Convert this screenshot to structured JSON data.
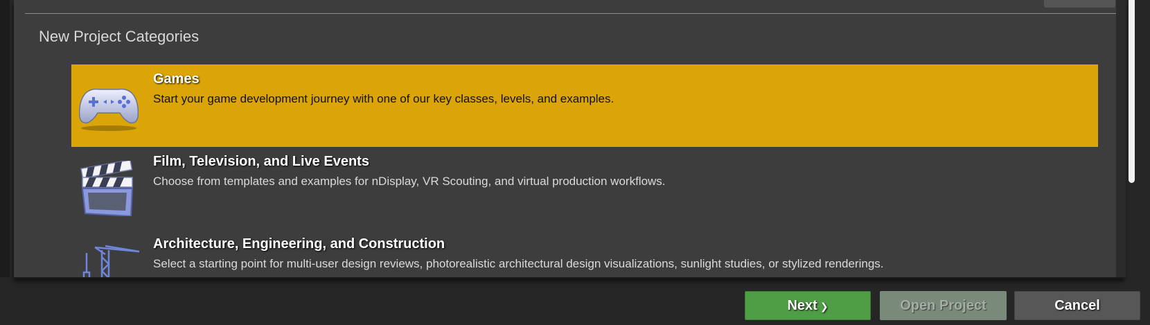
{
  "section_title": "New Project Categories",
  "categories": [
    {
      "title": "Games",
      "description": "Start your game development journey with one of our key classes, levels, and examples.",
      "icon": "gamepad-icon",
      "selected": true
    },
    {
      "title": "Film, Television, and Live Events",
      "description": "Choose from templates and examples for nDisplay, VR Scouting, and virtual production workflows.",
      "icon": "clapperboard-icon",
      "selected": false
    },
    {
      "title": "Architecture, Engineering, and Construction",
      "description": "Select a starting point for multi-user design reviews, photorealistic architectural design visualizations, sunlight studies, or stylized renderings.",
      "icon": "crane-icon",
      "selected": false
    }
  ],
  "buttons": {
    "next": "Next",
    "open_project": "Open Project",
    "cancel": "Cancel"
  },
  "colors": {
    "selected_highlight": "#dba407",
    "next_button": "#4f9e45",
    "panel_background": "#3d3d3d"
  }
}
